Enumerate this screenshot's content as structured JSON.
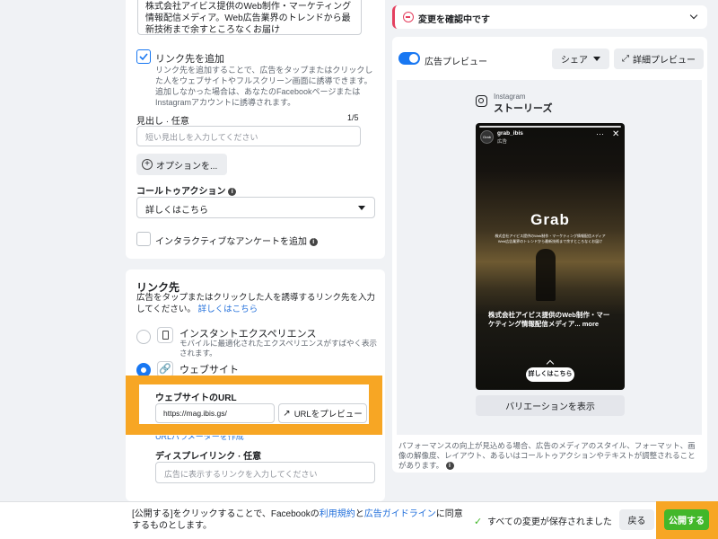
{
  "left": {
    "primary_text": "株式会社アイビス提供のWeb制作・マーケティング情報配信メディア。Web広告業界のトレンドから最新技術まで余すところなくお届け",
    "add_link": {
      "label": "リンク先を追加",
      "description": "リンク先を追加することで、広告をタップまたはクリックした人をウェブサイトやフルスクリーン画面に誘導できます。追加しなかった場合は、あなたのFacebookページまたはInstagramアカウントに誘導されます。"
    },
    "headline": {
      "label": "見出し · 任意",
      "counter": "1/5",
      "placeholder": "短い見出しを入力してください"
    },
    "options_button": "オプションを...",
    "cta": {
      "label": "コールトゥアクション",
      "value": "詳しくはこちら"
    },
    "survey_label": "インタラクティブなアンケートを追加",
    "destination": {
      "title": "リンク先",
      "description": "広告をタップまたはクリックした人を誘導するリンク先を入力してください。",
      "learn_more": "詳しくはこちら",
      "instant_title": "インスタントエクスペリエンス",
      "instant_desc": "モバイルに最適化されたエクスペリエンスがすばやく表示されます。",
      "website_title": "ウェブサイト",
      "url_label": "ウェブサイトのURL",
      "url_value": "https://mag.ibis.gs/",
      "url_preview_button": "URLをプレビュー",
      "url_params_link": "URLパラメーターを作成",
      "display_link_label": "ディスプレイリンク · 任意",
      "display_link_placeholder": "広告に表示するリンクを入力してください"
    }
  },
  "right": {
    "alert_text": "変更を確認中です",
    "preview_toggle_label": "広告プレビュー",
    "share_button": "シェア",
    "detail_preview_button": "詳細プレビュー",
    "placement_platform": "Instagram",
    "placement_name": "ストーリーズ",
    "story": {
      "account": "grab_ibis",
      "sponsored": "広告",
      "badge": "Grab",
      "brand": "Grab",
      "tagline_1": "株式会社アイビス提供のWeb制作・マーケティング情報配信メディア",
      "tagline_2": "Web広告業界のトレンドから最新技術まで余すところなくお届け",
      "caption": "株式会社アイビス提供のWeb制作・マーケティング情報配信メディア...",
      "more": "more",
      "cta_button": "詳しくはこちら"
    },
    "variations_button": "バリエーションを表示",
    "footnote": "パフォーマンスの向上が見込める場合、広告のメディアのスタイル、フォーマット、画像の解像度、レイアウト、あるいはコールトゥアクションやテキストが調整されることがあります。"
  },
  "footer": {
    "terms_prefix": "[公開する]をクリックすることで、Facebookの",
    "terms_link_1": "利用規約",
    "terms_mid": "と",
    "terms_link_2": "広告ガイドライン",
    "terms_suffix": "に同意するものとします。",
    "saved_text": "すべての変更が保存されました",
    "back_button": "戻る",
    "publish_button": "公開する"
  },
  "colors": {
    "brand_blue": "#1877f2",
    "link_blue": "#216fdb",
    "publish_green": "#42b72a",
    "highlight_orange": "#f7a624",
    "alert_red": "#e4405f"
  }
}
